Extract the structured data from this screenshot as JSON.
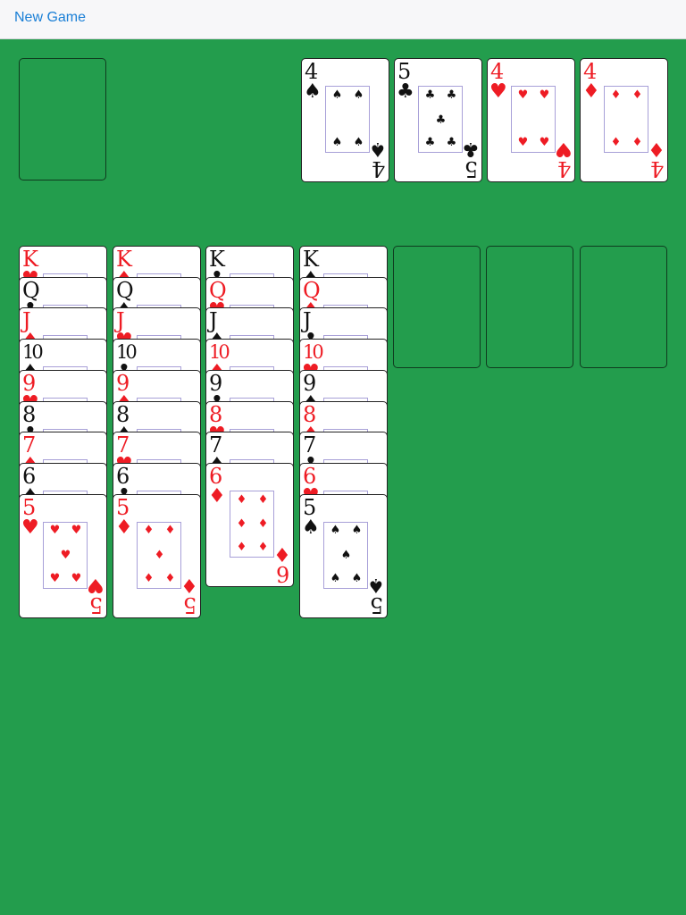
{
  "toolbar": {
    "new_game_label": "New Game"
  },
  "foundations": [
    {
      "rank": "4",
      "suit": "♠",
      "color": "black"
    },
    {
      "rank": "5",
      "suit": "♣",
      "color": "black"
    },
    {
      "rank": "4",
      "suit": "♥",
      "color": "red"
    },
    {
      "rank": "4",
      "suit": "♦",
      "color": "red"
    }
  ],
  "tableau": [
    [
      {
        "rank": "K",
        "suit": "♥",
        "color": "red"
      },
      {
        "rank": "Q",
        "suit": "♣",
        "color": "black"
      },
      {
        "rank": "J",
        "suit": "♦",
        "color": "red"
      },
      {
        "rank": "10",
        "suit": "♠",
        "color": "black"
      },
      {
        "rank": "9",
        "suit": "♥",
        "color": "red"
      },
      {
        "rank": "8",
        "suit": "♣",
        "color": "black"
      },
      {
        "rank": "7",
        "suit": "♦",
        "color": "red"
      },
      {
        "rank": "6",
        "suit": "♠",
        "color": "black"
      },
      {
        "rank": "5",
        "suit": "♥",
        "color": "red"
      }
    ],
    [
      {
        "rank": "K",
        "suit": "♦",
        "color": "red"
      },
      {
        "rank": "Q",
        "suit": "♠",
        "color": "black"
      },
      {
        "rank": "J",
        "suit": "♥",
        "color": "red"
      },
      {
        "rank": "10",
        "suit": "♣",
        "color": "black"
      },
      {
        "rank": "9",
        "suit": "♦",
        "color": "red"
      },
      {
        "rank": "8",
        "suit": "♠",
        "color": "black"
      },
      {
        "rank": "7",
        "suit": "♥",
        "color": "red"
      },
      {
        "rank": "6",
        "suit": "♣",
        "color": "black"
      },
      {
        "rank": "5",
        "suit": "♦",
        "color": "red"
      }
    ],
    [
      {
        "rank": "K",
        "suit": "♣",
        "color": "black"
      },
      {
        "rank": "Q",
        "suit": "♥",
        "color": "red"
      },
      {
        "rank": "J",
        "suit": "♠",
        "color": "black"
      },
      {
        "rank": "10",
        "suit": "♦",
        "color": "red"
      },
      {
        "rank": "9",
        "suit": "♣",
        "color": "black"
      },
      {
        "rank": "8",
        "suit": "♥",
        "color": "red"
      },
      {
        "rank": "7",
        "suit": "♠",
        "color": "black"
      },
      {
        "rank": "6",
        "suit": "♦",
        "color": "red"
      }
    ],
    [
      {
        "rank": "K",
        "suit": "♠",
        "color": "black"
      },
      {
        "rank": "Q",
        "suit": "♦",
        "color": "red"
      },
      {
        "rank": "J",
        "suit": "♣",
        "color": "black"
      },
      {
        "rank": "10",
        "suit": "♥",
        "color": "red"
      },
      {
        "rank": "9",
        "suit": "♠",
        "color": "black"
      },
      {
        "rank": "8",
        "suit": "♦",
        "color": "red"
      },
      {
        "rank": "7",
        "suit": "♣",
        "color": "black"
      },
      {
        "rank": "6",
        "suit": "♥",
        "color": "red"
      },
      {
        "rank": "5",
        "suit": "♠",
        "color": "black"
      }
    ]
  ],
  "colors": {
    "felt": "#239d4d",
    "red_suit": "#ee1c24",
    "black_suit": "#111111",
    "link": "#1a7fd6"
  }
}
